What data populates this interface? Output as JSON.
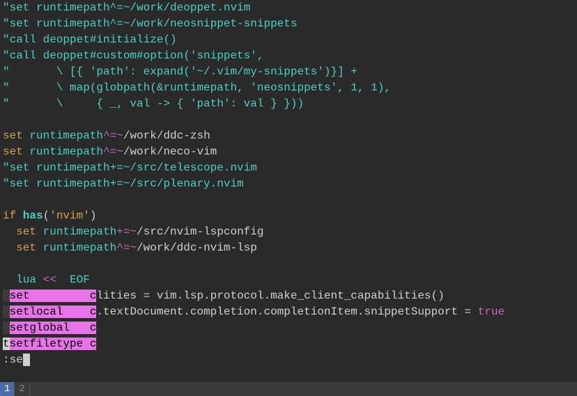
{
  "lines": {
    "l1": "\"set runtimepath^=~/work/deoppet.nvim",
    "l2": "\"set runtimepath^=~/work/neosnippet-snippets",
    "l3": "\"call deoppet#initialize()",
    "l4": "\"call deoppet#custom#option('snippets',",
    "l5": "\"       \\ [{ 'path': expand('~/.vim/my-snippets')}] +",
    "l6": "\"       \\ map(globpath(&runtimepath, 'neosnippets', 1, 1),",
    "l7": "\"       \\     { _, val -> { 'path': val } }))",
    "l8_set": "set",
    "l8_opt": " runtimepath",
    "l8_op": "^=~",
    "l8_rest": "/work/ddc-zsh",
    "l9_set": "set",
    "l9_opt": " runtimepath",
    "l9_op": "^=~",
    "l9_rest": "/work/neco-vim",
    "l10": "\"set runtimepath+=~/src/telescope.nvim",
    "l11": "\"set runtimepath+=~/src/plenary.nvim",
    "if_kw": "if",
    "has_fn": " has",
    "has_paren_o": "(",
    "has_arg": "'nvim'",
    "has_paren_c": ")",
    "l14_set": "  set",
    "l14_opt": " runtimepath",
    "l14_op": "+=~",
    "l14_rest": "/src/nvim-lspconfig",
    "l15_set": "  set",
    "l15_opt": " runtimepath",
    "l15_op": "^=~",
    "l15_rest": "/work/ddc-nvim-lsp",
    "lua_kw": "  lua ",
    "lua_op": "<< ",
    "lua_eof": " EOF",
    "p1_left": " ",
    "p1_match": "set         c",
    "p1_rest": "lities = vim.lsp.protocol.make_client_capabilities()",
    "p2_left": " ",
    "p2_match": "setlocal    c",
    "p2_rest": ".textDocument.completion.completionItem.snippetSupport = ",
    "p2_true": "true",
    "p3_left": " ",
    "p3_match": "setglobal   c",
    "p4_pre": "t",
    "p4_match": "setfiletype c",
    "cmdline": ":se",
    "tab1": "1",
    "tab2": "2"
  },
  "completion_items": [
    "set",
    "setlocal",
    "setglobal",
    "setfiletype"
  ],
  "typed_command": ":se"
}
